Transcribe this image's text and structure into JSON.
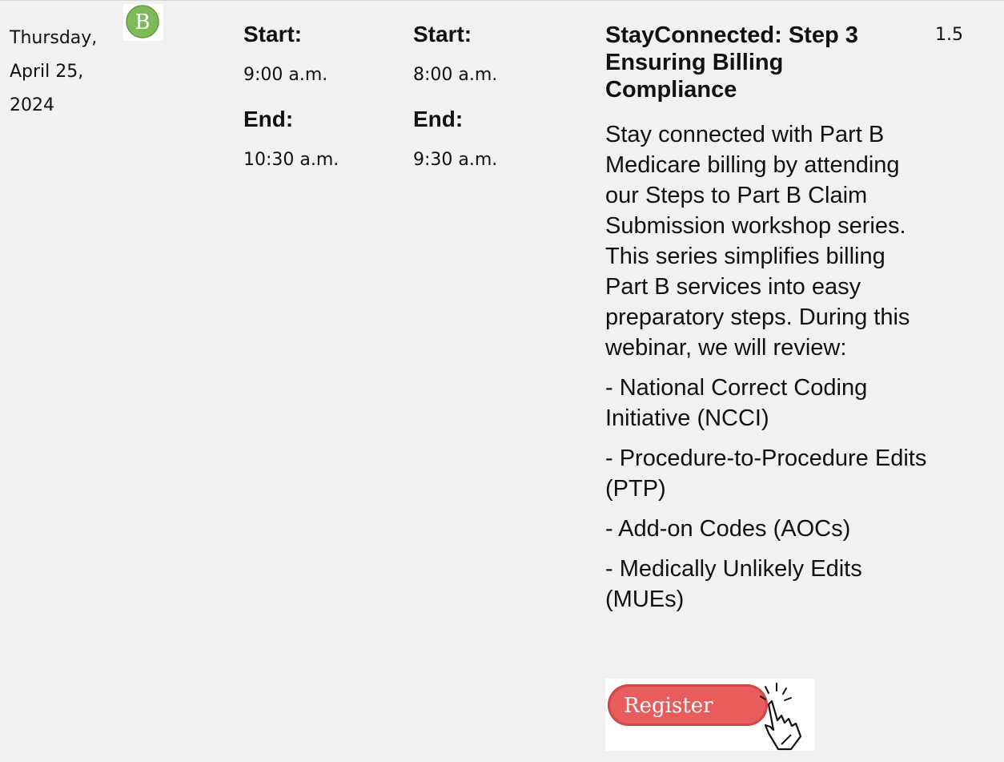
{
  "event": {
    "date_lines": [
      "Thursday,",
      "April 25,",
      "2024"
    ],
    "badge_letter": "B",
    "time_col_1": {
      "start_label": "Start:",
      "start_time": "9:00 a.m.",
      "end_label": "End:",
      "end_time": "10:30 a.m."
    },
    "time_col_2": {
      "start_label": "Start:",
      "start_time": "8:00 a.m.",
      "end_label": "End:",
      "end_time": "9:30 a.m."
    },
    "title": "StayConnected: Step 3\nEnsuring Billing\nCompliance",
    "description": "Stay connected with Part B Medicare billing by attending our Steps to Part B Claim Submission workshop series. This series simplifies billing Part B services into easy preparatory steps. During this webinar, we will review:",
    "bullets": [
      "- National Correct Coding Initiative (NCCI)",
      "- Procedure-to-Procedure Edits (PTP)",
      "- Add-on Codes (AOCs)",
      "- Medically Unlikely Edits (MUEs)"
    ],
    "register_label": "Register",
    "credits": "1.5"
  },
  "colors": {
    "row_bg": "#f1f1f1",
    "badge_green": "#7dbb5a",
    "register_red": "#e85c5c"
  },
  "icons": {
    "badge": "letter-b-badge-icon",
    "pointer": "pointing-hand-icon"
  }
}
